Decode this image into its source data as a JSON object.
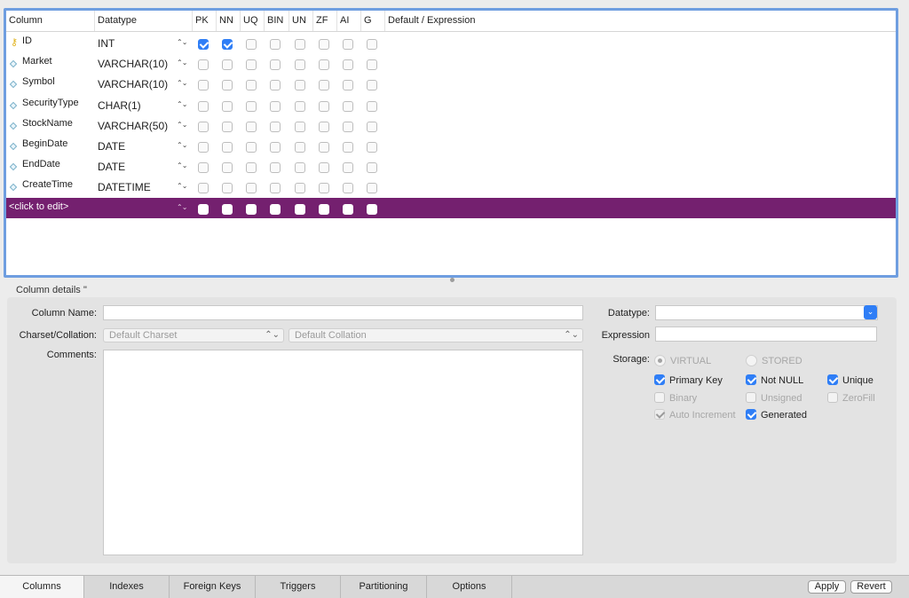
{
  "grid": {
    "headers": {
      "column": "Column",
      "datatype": "Datatype",
      "pk": "PK",
      "nn": "NN",
      "uq": "UQ",
      "bin": "BIN",
      "un": "UN",
      "zf": "ZF",
      "ai": "AI",
      "g": "G",
      "default": "Default / Expression"
    },
    "rows": [
      {
        "name": "ID",
        "type": "INT",
        "icon": "key-icon",
        "flags": [
          true,
          true,
          false,
          false,
          false,
          false,
          false,
          false
        ]
      },
      {
        "name": "Market",
        "type": "VARCHAR(10)",
        "icon": "column-diamond-icon",
        "flags": [
          false,
          false,
          false,
          false,
          false,
          false,
          false,
          false
        ]
      },
      {
        "name": "Symbol",
        "type": "VARCHAR(10)",
        "icon": "column-diamond-icon",
        "flags": [
          false,
          false,
          false,
          false,
          false,
          false,
          false,
          false
        ]
      },
      {
        "name": "SecurityType",
        "type": "CHAR(1)",
        "icon": "column-diamond-icon",
        "flags": [
          false,
          false,
          false,
          false,
          false,
          false,
          false,
          false
        ]
      },
      {
        "name": "StockName",
        "type": "VARCHAR(50)",
        "icon": "column-diamond-icon",
        "flags": [
          false,
          false,
          false,
          false,
          false,
          false,
          false,
          false
        ]
      },
      {
        "name": "BeginDate",
        "type": "DATE",
        "icon": "column-diamond-icon",
        "flags": [
          false,
          false,
          false,
          false,
          false,
          false,
          false,
          false
        ]
      },
      {
        "name": "EndDate",
        "type": "DATE",
        "icon": "column-diamond-icon",
        "flags": [
          false,
          false,
          false,
          false,
          false,
          false,
          false,
          false
        ]
      },
      {
        "name": "CreateTime",
        "type": "DATETIME",
        "icon": "column-diamond-icon",
        "flags": [
          false,
          false,
          false,
          false,
          false,
          false,
          false,
          false
        ]
      }
    ],
    "new_row_label": "<click to edit>",
    "new_row_color": "#74206f",
    "focus_border_color": "#6f9ee0"
  },
  "details": {
    "title": "Column details ''",
    "column_name_label": "Column Name:",
    "column_name_value": "",
    "charset_label": "Charset/Collation:",
    "charset_value": "Default Charset",
    "collation_value": "Default Collation",
    "comments_label": "Comments:",
    "comments_value": "",
    "datatype_label": "Datatype:",
    "datatype_value": "",
    "expression_label": "Expression",
    "expression_value": "",
    "storage_label": "Storage:",
    "storage_virtual": "VIRTUAL",
    "storage_stored": "STORED",
    "options": {
      "primary_key": "Primary Key",
      "not_null": "Not NULL",
      "unique": "Unique",
      "binary": "Binary",
      "unsigned": "Unsigned",
      "zerofill": "ZeroFill",
      "auto_increment": "Auto Increment",
      "generated": "Generated"
    }
  },
  "tabs": [
    "Columns",
    "Indexes",
    "Foreign Keys",
    "Triggers",
    "Partitioning",
    "Options"
  ],
  "active_tab": "Columns",
  "buttons": {
    "apply": "Apply",
    "revert": "Revert"
  },
  "accent_color": "#2f7ef6"
}
